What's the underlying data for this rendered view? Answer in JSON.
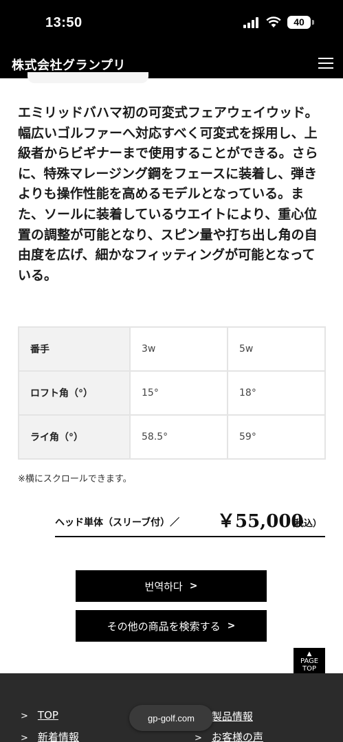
{
  "status_bar": {
    "time": "13:50",
    "battery": "40"
  },
  "header": {
    "brand": "株式会社グランプリ"
  },
  "description": "エミリッドバハマ初の可変式フェアウェイウッド。\n幅広いゴルファーへ対応すべく可変式を採用し、上級者からビギナーまで使用することができる。さらに、特殊マレージング鋼をフェースに装着し、弾きよりも操作性能を高めるモデルとなっている。また、ソールに装着しているウエイトにより、重心位置の調整が可能となり、スピン量や打ち出し角の自由度を広げ、細かなフィッティングが可能となっている。",
  "spec_table": {
    "rows": [
      {
        "label": "番手",
        "values": [
          "3w",
          "5w"
        ]
      },
      {
        "label": "ロフト角（°）",
        "values": [
          "15°",
          "18°"
        ]
      },
      {
        "label": "ライ角（°）",
        "values": [
          "58.5°",
          "59°"
        ]
      }
    ]
  },
  "scroll_note": "※横にスクロールできます。",
  "price": {
    "label": "ヘッド単体（スリーブ付）／",
    "value": "￥55,000",
    "tax": "（税込）"
  },
  "buttons": {
    "translate": "번역하다",
    "search_other": "その他の商品を検索する"
  },
  "page_top": {
    "line1": "PAGE",
    "line2": "TOP"
  },
  "footer": {
    "links_left": [
      "TOP",
      "新着情報"
    ],
    "links_right": [
      "製品情報",
      "お客様の声"
    ]
  },
  "browser": {
    "url": "gp-golf.com"
  }
}
